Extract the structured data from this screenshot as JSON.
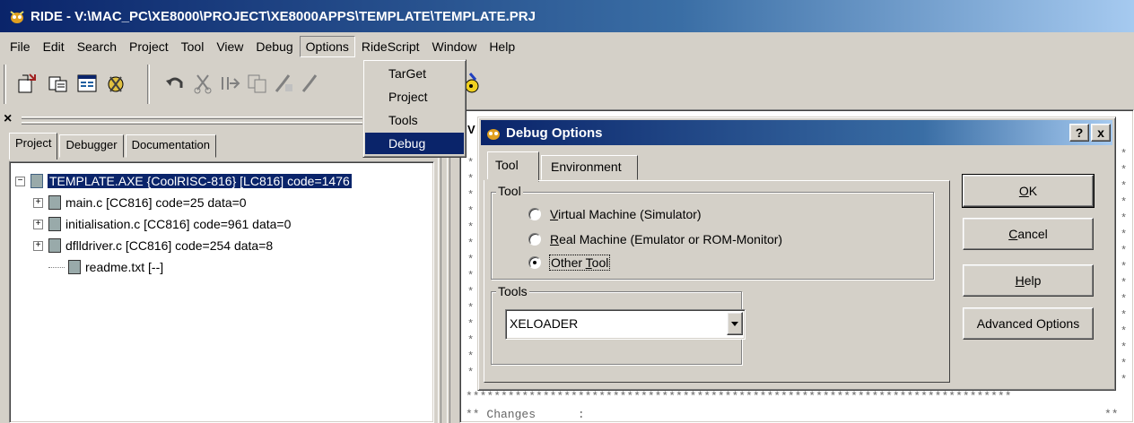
{
  "window": {
    "title": "RIDE - V:\\MAC_PC\\XE8000\\PROJECT\\XE8000APPS\\TEMPLATE\\TEMPLATE.PRJ"
  },
  "menubar": [
    "File",
    "Edit",
    "Search",
    "Project",
    "Tool",
    "View",
    "Debug",
    "Options",
    "RideScript",
    "Window",
    "Help"
  ],
  "options_menu": {
    "items": [
      "TarGet",
      "Project",
      "Tools",
      "Debug"
    ],
    "selected": "Debug"
  },
  "left_pane": {
    "close_glyph": "×",
    "tabs": [
      "Project",
      "Debugger",
      "Documentation"
    ],
    "active_tab": "Project",
    "tree": [
      {
        "label": "TEMPLATE.AXE {CoolRISC-816} [LC816] code=1476",
        "level": 0,
        "expander": "−",
        "selected": true
      },
      {
        "label": "main.c [CC816] code=25 data=0",
        "level": 1,
        "expander": "+"
      },
      {
        "label": "initialisation.c [CC816] code=961 data=0",
        "level": 1,
        "expander": "+"
      },
      {
        "label": "dflldriver.c [CC816] code=254 data=8",
        "level": 1,
        "expander": "+"
      },
      {
        "label": "readme.txt [--]",
        "level": 1,
        "expander": ""
      }
    ]
  },
  "editor": {
    "visible_prefix": "V",
    "star_line": "******************************************************************************",
    "changes_line": "** Changes      :",
    "changes_right": "**"
  },
  "dialog": {
    "title": "Debug Options",
    "help_button": "?",
    "close_button": "x",
    "tabs": [
      "Tool",
      "Environment"
    ],
    "active_tab": "Tool",
    "tool_group_label": "Tool",
    "radios": [
      {
        "label": "Virtual Machine (Simulator)",
        "accel": "V",
        "rest": "irtual Machine (Simulator)",
        "checked": false
      },
      {
        "label": "Real Machine (Emulator or ROM-Monitor)",
        "accel": "R",
        "rest": "eal Machine (Emulator or ROM-Monitor)",
        "checked": false
      },
      {
        "label": "Other Tool",
        "pre": "Other ",
        "accel": "T",
        "rest": "ool",
        "checked": true
      }
    ],
    "tools_group_label": "Tools",
    "tools_value": "XELOADER",
    "buttons": {
      "ok": {
        "accel": "O",
        "rest": "K"
      },
      "cancel": {
        "accel": "C",
        "rest": "ancel"
      },
      "help": {
        "accel": "H",
        "rest": "elp"
      },
      "advanced": "Advanced Options"
    }
  }
}
